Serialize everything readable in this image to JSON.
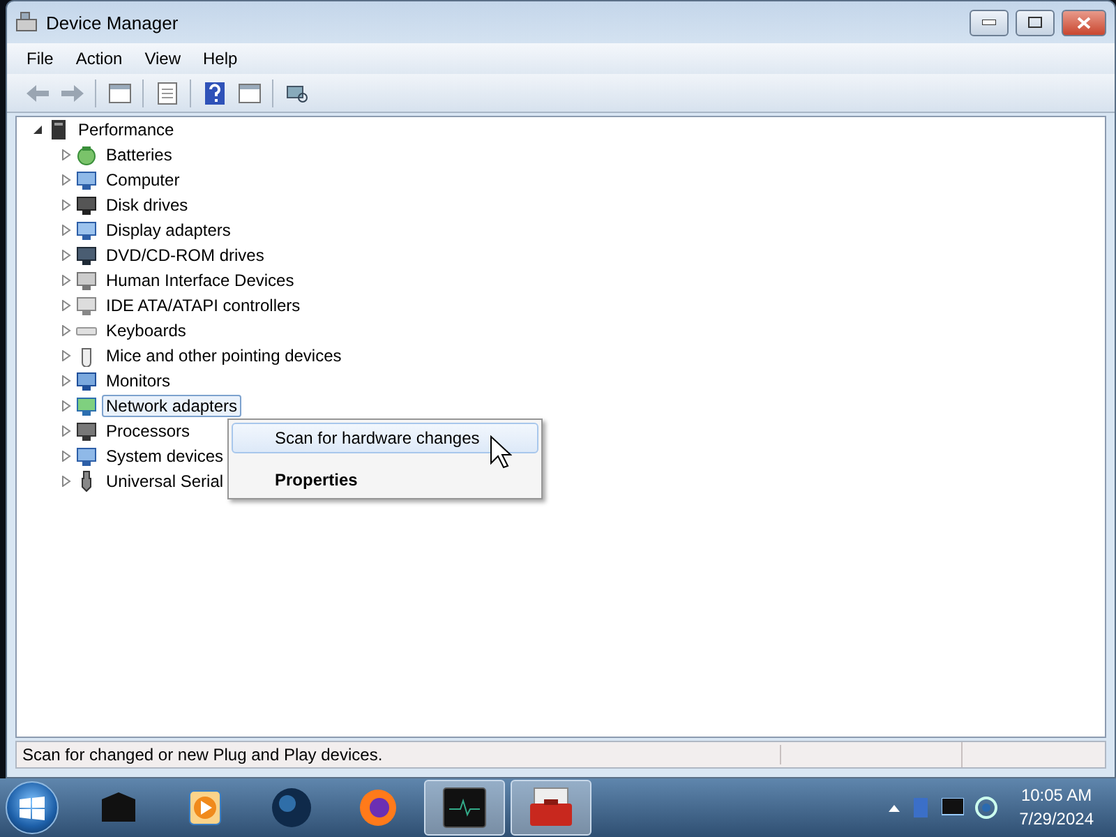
{
  "window": {
    "title": "Device Manager"
  },
  "menu": [
    "File",
    "Action",
    "View",
    "Help"
  ],
  "tree": {
    "label": "Performance",
    "expanded": true,
    "children": [
      {
        "label": "Batteries",
        "kind": "battery",
        "expanded": false,
        "selected": false
      },
      {
        "label": "Computer",
        "kind": "computer",
        "expanded": false,
        "selected": false
      },
      {
        "label": "Disk drives",
        "kind": "disk",
        "expanded": false,
        "selected": false
      },
      {
        "label": "Display adapters",
        "kind": "display",
        "expanded": false,
        "selected": false
      },
      {
        "label": "DVD/CD-ROM drives",
        "kind": "dvd",
        "expanded": false,
        "selected": false
      },
      {
        "label": "Human Interface Devices",
        "kind": "hid",
        "expanded": false,
        "selected": false
      },
      {
        "label": "IDE ATA/ATAPI controllers",
        "kind": "ide",
        "expanded": false,
        "selected": false
      },
      {
        "label": "Keyboards",
        "kind": "keyboard",
        "expanded": false,
        "selected": false
      },
      {
        "label": "Mice and other pointing devices",
        "kind": "mouse",
        "expanded": false,
        "selected": false
      },
      {
        "label": "Monitors",
        "kind": "monitor",
        "expanded": false,
        "selected": false
      },
      {
        "label": "Network adapters",
        "kind": "network",
        "expanded": false,
        "selected": true
      },
      {
        "label": "Processors",
        "kind": "cpu",
        "expanded": false,
        "selected": false
      },
      {
        "label": "System devices",
        "kind": "system",
        "expanded": false,
        "selected": false
      },
      {
        "label": "Universal Serial",
        "kind": "usb",
        "expanded": false,
        "selected": false
      }
    ]
  },
  "context_menu": [
    {
      "label": "Scan for hardware changes",
      "selected": true,
      "bold": false
    },
    {
      "label": "Properties",
      "selected": false,
      "bold": true
    }
  ],
  "status_bar": "Scan for changed or new Plug and Play devices.",
  "taskbar": {
    "apps": [
      {
        "kind": "box",
        "selected": false
      },
      {
        "kind": "media",
        "selected": false
      },
      {
        "kind": "globe",
        "selected": false
      },
      {
        "kind": "browser",
        "selected": false
      },
      {
        "kind": "monitor",
        "selected": true
      },
      {
        "kind": "toolbox",
        "selected": true
      }
    ],
    "time": "10:05 AM",
    "date": "7/29/2024"
  }
}
